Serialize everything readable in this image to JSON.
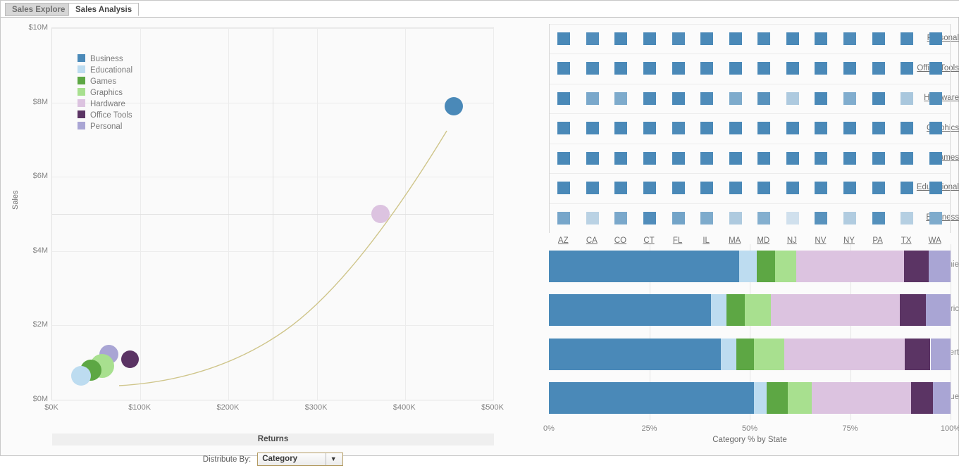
{
  "tabs": [
    {
      "label": "Sales Explore",
      "active": false
    },
    {
      "label": "Sales Analysis",
      "active": true
    }
  ],
  "colors": {
    "business": "#4a89b8",
    "educational": "#bddcf0",
    "games": "#5da744",
    "graphics": "#a8e08f",
    "hardware": "#dcc3e0",
    "office_tools": "#5b3464",
    "personal": "#a9a5d4",
    "trendline": "#cfc58a",
    "heat_base": "#4a89b8",
    "axis_text": "#848484",
    "tab_active_bg": "#ffffff",
    "tab_inactive_bg": "#d6d6d6"
  },
  "scatter": {
    "y_axis_title": "Sales",
    "x_axis_title": "Returns",
    "y_ticks": [
      "$10M",
      "$8M",
      "$6M",
      "$4M",
      "$2M",
      "$0M"
    ],
    "x_ticks": [
      "$0K",
      "$100K",
      "$200K",
      "$300K",
      "$400K",
      "$500K"
    ],
    "legend": [
      {
        "label": "Business",
        "color": "#4a89b8"
      },
      {
        "label": "Educational",
        "color": "#bddcf0"
      },
      {
        "label": "Games",
        "color": "#5da744"
      },
      {
        "label": "Graphics",
        "color": "#a8e08f"
      },
      {
        "label": "Hardware",
        "color": "#dcc3e0"
      },
      {
        "label": "Office Tools",
        "color": "#5b3464"
      },
      {
        "label": "Personal",
        "color": "#a9a5d4"
      }
    ]
  },
  "chart_data": [
    {
      "type": "scatter",
      "title": "",
      "xlabel": "Returns",
      "ylabel": "Sales",
      "xlim": [
        0,
        500000
      ],
      "ylim": [
        0,
        10000000
      ],
      "x_tick_values": [
        0,
        100000,
        200000,
        300000,
        400000,
        500000
      ],
      "y_tick_values": [
        0,
        2000000,
        4000000,
        6000000,
        8000000,
        10000000
      ],
      "grid": true,
      "reference_lines": {
        "horizontal_y": 5000000,
        "vertical_x": 250000
      },
      "trendline": true,
      "legend_position": "top-left",
      "points": [
        {
          "name": "Business",
          "x": 455000,
          "y": 7900000,
          "size": 26,
          "color": "#4a89b8"
        },
        {
          "name": "Hardware",
          "x": 372000,
          "y": 5000000,
          "size": 26,
          "color": "#dcc3e0"
        },
        {
          "name": "Office Tools",
          "x": 88000,
          "y": 1080000,
          "size": 25,
          "color": "#5b3464"
        },
        {
          "name": "Personal",
          "x": 64000,
          "y": 1230000,
          "size": 27,
          "color": "#a9a5d4"
        },
        {
          "name": "Graphics",
          "x": 57000,
          "y": 900000,
          "size": 34,
          "color": "#a8e08f"
        },
        {
          "name": "Games",
          "x": 44000,
          "y": 800000,
          "size": 30,
          "color": "#5da744"
        },
        {
          "name": "Educational",
          "x": 33000,
          "y": 640000,
          "size": 28,
          "color": "#bddcf0"
        }
      ]
    },
    {
      "type": "heatmap",
      "title": "",
      "xlabel": "",
      "ylabel": "",
      "rows": [
        "Personal",
        "Office Tools",
        "Hardware",
        "Graphics",
        "Games",
        "Educational",
        "Business"
      ],
      "columns": [
        "AZ",
        "CA",
        "CO",
        "CT",
        "FL",
        "IL",
        "MA",
        "MD",
        "NJ",
        "NV",
        "NY",
        "PA",
        "TX",
        "WA"
      ],
      "base_color": "#4a89b8",
      "values": [
        [
          1.0,
          0.96,
          1.0,
          1.0,
          0.97,
          1.0,
          1.0,
          0.98,
          1.0,
          1.0,
          0.97,
          1.0,
          0.99,
          1.0
        ],
        [
          1.0,
          0.98,
          1.0,
          1.0,
          1.0,
          0.99,
          1.0,
          1.0,
          1.0,
          1.0,
          1.0,
          0.99,
          1.0,
          1.0
        ],
        [
          1.0,
          0.72,
          0.7,
          0.98,
          1.0,
          0.97,
          0.7,
          0.92,
          0.42,
          1.0,
          0.68,
          1.0,
          0.45,
          0.95
        ],
        [
          1.0,
          1.0,
          1.0,
          1.0,
          0.98,
          1.0,
          1.0,
          1.0,
          1.0,
          1.0,
          1.0,
          1.0,
          1.0,
          1.0
        ],
        [
          1.0,
          1.0,
          1.0,
          1.0,
          1.0,
          0.99,
          1.0,
          1.0,
          1.0,
          1.0,
          1.0,
          1.0,
          1.0,
          1.0
        ],
        [
          1.0,
          1.0,
          1.0,
          1.0,
          1.0,
          1.0,
          1.0,
          1.0,
          1.0,
          1.0,
          1.0,
          1.0,
          1.0,
          1.0
        ],
        [
          0.74,
          0.35,
          0.72,
          0.96,
          0.76,
          0.7,
          0.42,
          0.66,
          0.22,
          0.92,
          0.4,
          0.94,
          0.38,
          0.7
        ]
      ]
    },
    {
      "type": "bar",
      "subtype": "stacked-horizontal-100",
      "title": "",
      "xlabel": "Category % by State",
      "ylabel": "",
      "xlim": [
        0,
        100
      ],
      "x_tick_values": [
        0,
        25,
        50,
        75,
        100
      ],
      "x_tick_labels": [
        "0%",
        "25%",
        "50%",
        "75%",
        "100%"
      ],
      "categories": [
        "Annie",
        "Eric",
        "Robert",
        "Sue"
      ],
      "grid": true,
      "legend_position": "none",
      "series": [
        {
          "name": "Business",
          "color": "#4a89b8",
          "values": [
            47.3,
            40.3,
            42.8,
            51.1
          ]
        },
        {
          "name": "Educational",
          "color": "#bddcf0",
          "values": [
            4.4,
            3.9,
            3.9,
            3.1
          ]
        },
        {
          "name": "Games",
          "color": "#5da744",
          "values": [
            4.7,
            4.6,
            4.4,
            5.3
          ]
        },
        {
          "name": "Graphics",
          "color": "#a8e08f",
          "values": [
            5.2,
            6.4,
            7.5,
            5.9
          ]
        },
        {
          "name": "Hardware",
          "color": "#dcc3e0",
          "values": [
            26.8,
            32.1,
            30.0,
            24.7
          ]
        },
        {
          "name": "Office Tools",
          "color": "#5b3464",
          "values": [
            6.2,
            6.5,
            6.4,
            5.5
          ]
        },
        {
          "name": "Personal",
          "color": "#a9a5d4",
          "values": [
            5.4,
            6.2,
            5.0,
            4.4
          ]
        }
      ]
    }
  ],
  "controls": {
    "distribute_label": "Distribute By:",
    "distribute_value": "Category",
    "dropdown_arrow": "▼"
  }
}
